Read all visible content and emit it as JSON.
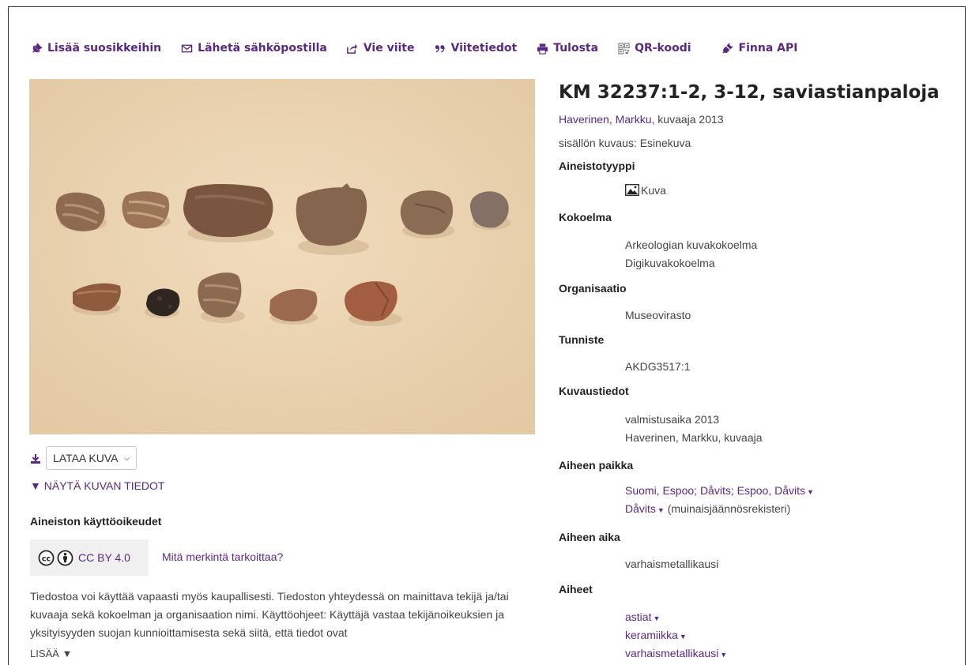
{
  "toolbar": {
    "favorite": "Lisää suosikkeihin",
    "email": "Lähetä sähköpostilla",
    "export": "Vie viite",
    "cite": "Viitetiedot",
    "print": "Tulosta",
    "qr": "QR-koodi",
    "api": "Finna API"
  },
  "image": {
    "download_label": "LATAA KUVA",
    "show_info": "▼ NÄYTÄ KUVAN TIEDOT"
  },
  "rights": {
    "heading": "Aineiston käyttöoikeudet",
    "license": "CC BY 4.0",
    "meaning_link": "Mitä merkintä tarkoittaa?",
    "description": "Tiedostoa voi käyttää vapaasti myös kaupallisesti. Tiedoston yhteydessä on mainittava tekijä ja/tai kuvaaja sekä kokoelman ja organisaation nimi. Käyttöohjeet: Käyttäjä vastaa tekijänoikeuksien ja yksityisyyden suojan kunnioittamisesta sekä siitä, että tiedot ovat",
    "more": "LISÄÄ ▼"
  },
  "record": {
    "title": "KM 32237:1-2, 3-12, saviastianpaloja",
    "author_link": "Haverinen, Markku,",
    "author_role": " kuvaaja 2013",
    "content_desc": "sisällön kuvaus: Esinekuva",
    "fields": {
      "format_label": "Aineistotyyppi",
      "format_value": "Kuva",
      "collection_label": "Kokoelma",
      "collection_1": "Arkeologian kuvakokoelma",
      "collection_2": "Digikuvakokoelma",
      "org_label": "Organisaatio",
      "org_value": "Museovirasto",
      "id_label": "Tunniste",
      "id_value": "AKDG3517:1",
      "photo_label": "Kuvaustiedot",
      "photo_1": "valmistusaika 2013",
      "photo_2": "Haverinen, Markku, kuvaaja",
      "place_label": "Aiheen paikka",
      "place_1": "Suomi, Espoo; Dåvits; Espoo, Dåvits",
      "place_2_link": "Dåvits",
      "place_2_note": "(muinaisjäännösrekisteri)",
      "time_label": "Aiheen aika",
      "time_value": "varhaismetallikausi",
      "subjects_label": "Aiheet",
      "subjects": [
        "astiat",
        "keramiikka",
        "varhaismetallikausi"
      ]
    }
  },
  "colors": {
    "accent": "#5a2a82",
    "photo_bg": "#ebd5b5"
  }
}
